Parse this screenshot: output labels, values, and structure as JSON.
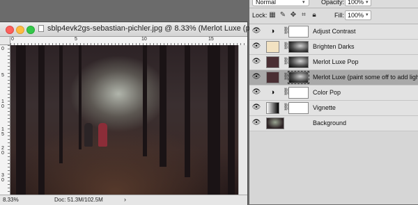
{
  "document": {
    "title": "sblp4evk2gs-sebastian-pichler.jpg @ 8.33% (Merlot Luxe (p...",
    "ruler_top": [
      "0",
      "5",
      "10",
      "15"
    ],
    "ruler_left": [
      "0",
      "5",
      "1 0",
      "1 5",
      "2 0",
      "3 0"
    ],
    "zoom": "8.33%",
    "doc_size": "Doc: 51.3M/102.5M",
    "nav_arrow": "›"
  },
  "panel": {
    "blend_mode": "Normal",
    "opacity_label": "Opacity:",
    "opacity_value": "100%",
    "lock_label": "Lock:",
    "fill_label": "Fill:",
    "fill_value": "100%"
  },
  "layers": [
    {
      "name": "Adjust Contrast",
      "type": "adjustment",
      "icon": "half-circle-icon",
      "mask": "white"
    },
    {
      "name": "Brighten Darks",
      "type": "fill",
      "thumb_color": "#f2e2c2",
      "mask": "dark"
    },
    {
      "name": "Merlot Luxe Pop",
      "type": "fill",
      "thumb_color": "#4a2f34",
      "mask": "dark"
    },
    {
      "name": "Merlot Luxe  (paint some off to add light)",
      "type": "fill",
      "thumb_color": "#4a2f34",
      "mask": "dark",
      "selected": true
    },
    {
      "name": "Color Pop",
      "type": "adjustment",
      "icon": "half-circle-icon",
      "mask": "white"
    },
    {
      "name": "Vignette",
      "type": "gradient",
      "mask": "white"
    },
    {
      "name": "Background",
      "type": "image"
    }
  ]
}
